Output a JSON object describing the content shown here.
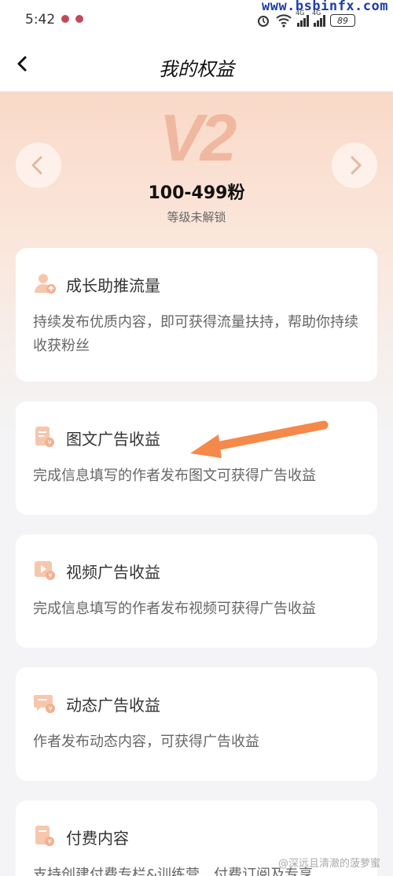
{
  "status": {
    "time": "5:42",
    "battery": "89",
    "signal_label": "4G"
  },
  "watermark_top": "www.bsbinfx.com",
  "nav": {
    "title": "我的权益"
  },
  "level": {
    "badge": "V2",
    "fans_range": "100-499粉",
    "status": "等级未解锁"
  },
  "cards": [
    {
      "title": "成长助推流量",
      "desc": "持续发布优质内容，即可获得流量扶持，帮助你持续收获粉丝",
      "icon": "user-growth-icon"
    },
    {
      "title": "图文广告收益",
      "desc": "完成信息填写的作者发布图文可获得广告收益",
      "icon": "document-coin-icon"
    },
    {
      "title": "视频广告收益",
      "desc": "完成信息填写的作者发布视频可获得广告收益",
      "icon": "video-coin-icon"
    },
    {
      "title": "动态广告收益",
      "desc": "作者发布动态内容，可获得广告收益",
      "icon": "post-coin-icon"
    },
    {
      "title": "付费内容",
      "desc": "支持创建付费专栏&训练营，付费订阅及专享",
      "icon": "paid-content-icon"
    }
  ],
  "bottom_watermark": "@深远且清澈的菠萝蜜",
  "colors": {
    "accent_orange": "#f5894a",
    "icon_tint": "#f6c7ad",
    "badge": "#f0b8a0"
  }
}
